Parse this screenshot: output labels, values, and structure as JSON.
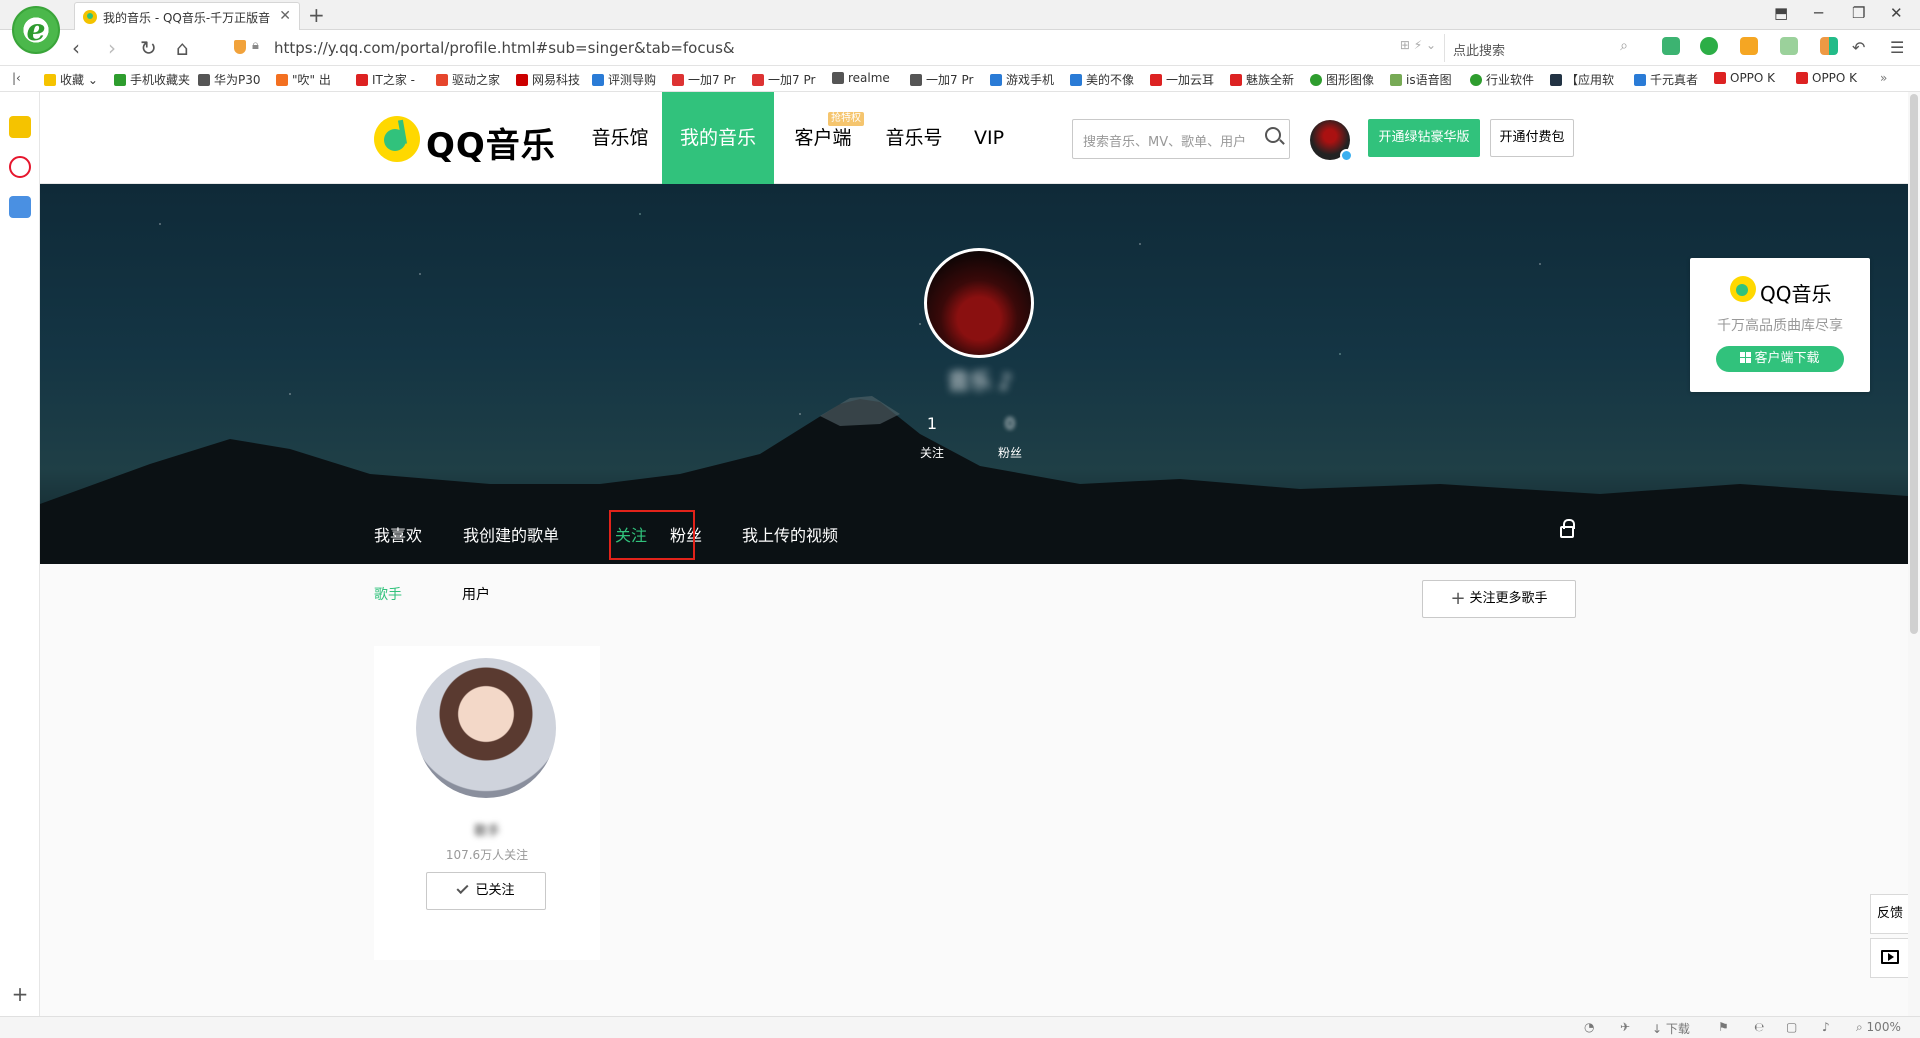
{
  "browser": {
    "tab_title": "我的音乐 - QQ音乐-千万正版音",
    "url": "https://y.qq.com/portal/profile.html#sub=singer&tab=focus&",
    "search_placeholder": "点此搜索",
    "logo_letter": "e",
    "bookmarks": [
      "收藏",
      "手机收藏夹",
      "华为P30",
      "\"吹\" 出",
      "IT之家 -",
      "驱动之家",
      "网易科技",
      "评测导购",
      "一加7 Pr",
      "一加7 Pr",
      "realme",
      "一加7 Pr",
      "游戏手机",
      "美的不像",
      "一加云耳",
      "魅族全新",
      "图形图像",
      "is语音图",
      "行业软件",
      "【应用软",
      "千元真者",
      "OPPO K",
      "OPPO K"
    ],
    "status": {
      "download": "下载",
      "zoom": "100%"
    }
  },
  "site": {
    "logo_text": "QQ音乐",
    "nav": [
      "音乐馆",
      "我的音乐",
      "客户端",
      "音乐号",
      "VIP"
    ],
    "nav_active": "我的音乐",
    "client_badge": "抢特权",
    "search_placeholder": "搜索音乐、MV、歌单、用户",
    "btn_vip": "开通绿钻豪华版",
    "btn_pay": "开通付费包"
  },
  "profile": {
    "name": "音乐 ♪",
    "following_count": "1",
    "following_label": "关注",
    "fans_count": "0",
    "fans_label": "粉丝",
    "tabs": [
      "我喜欢",
      "我创建的歌单",
      "关注",
      "粉丝",
      "我上传的视频"
    ],
    "active_tab": "关注"
  },
  "promo": {
    "title": "QQ音乐",
    "subtitle": "千万高品质曲库尽享",
    "button": "客户端下载"
  },
  "content": {
    "tabs": [
      "歌手",
      "用户"
    ],
    "active_tab": "歌手",
    "follow_more": "关注更多歌手",
    "singer": {
      "name": "歌手",
      "fans": "107.6万人关注",
      "followed_label": "已关注"
    }
  },
  "sidebar_right": {
    "feedback": "反馈"
  },
  "colors": {
    "accent": "#31c27c",
    "highlight": "#e2231a"
  }
}
